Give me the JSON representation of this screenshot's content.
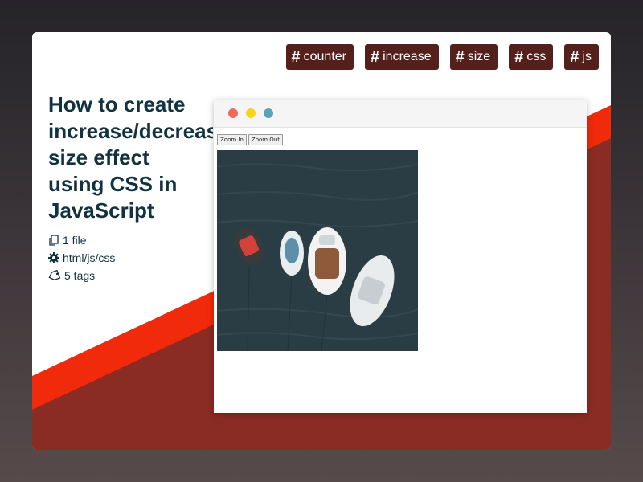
{
  "tags": [
    "counter",
    "increase",
    "size",
    "css",
    "js"
  ],
  "title_lines": [
    "How to create",
    "increase/decrease",
    "size effect",
    "using CSS in",
    "JavaScript"
  ],
  "meta": {
    "files": "1 file",
    "tech": "html/js/css",
    "tags_count": "5 tags"
  },
  "preview": {
    "zoom_in_label": "Zoom In",
    "zoom_out_label": "Zoom Out",
    "window_dots": [
      "#f0695a",
      "#f7d51d",
      "#5aa3b8"
    ],
    "image_alt": "boats on water"
  },
  "colors": {
    "tag_bg": "#55201c",
    "accent_red": "#f02a0a",
    "dark_red": "#8a2c24",
    "title": "#123240"
  }
}
